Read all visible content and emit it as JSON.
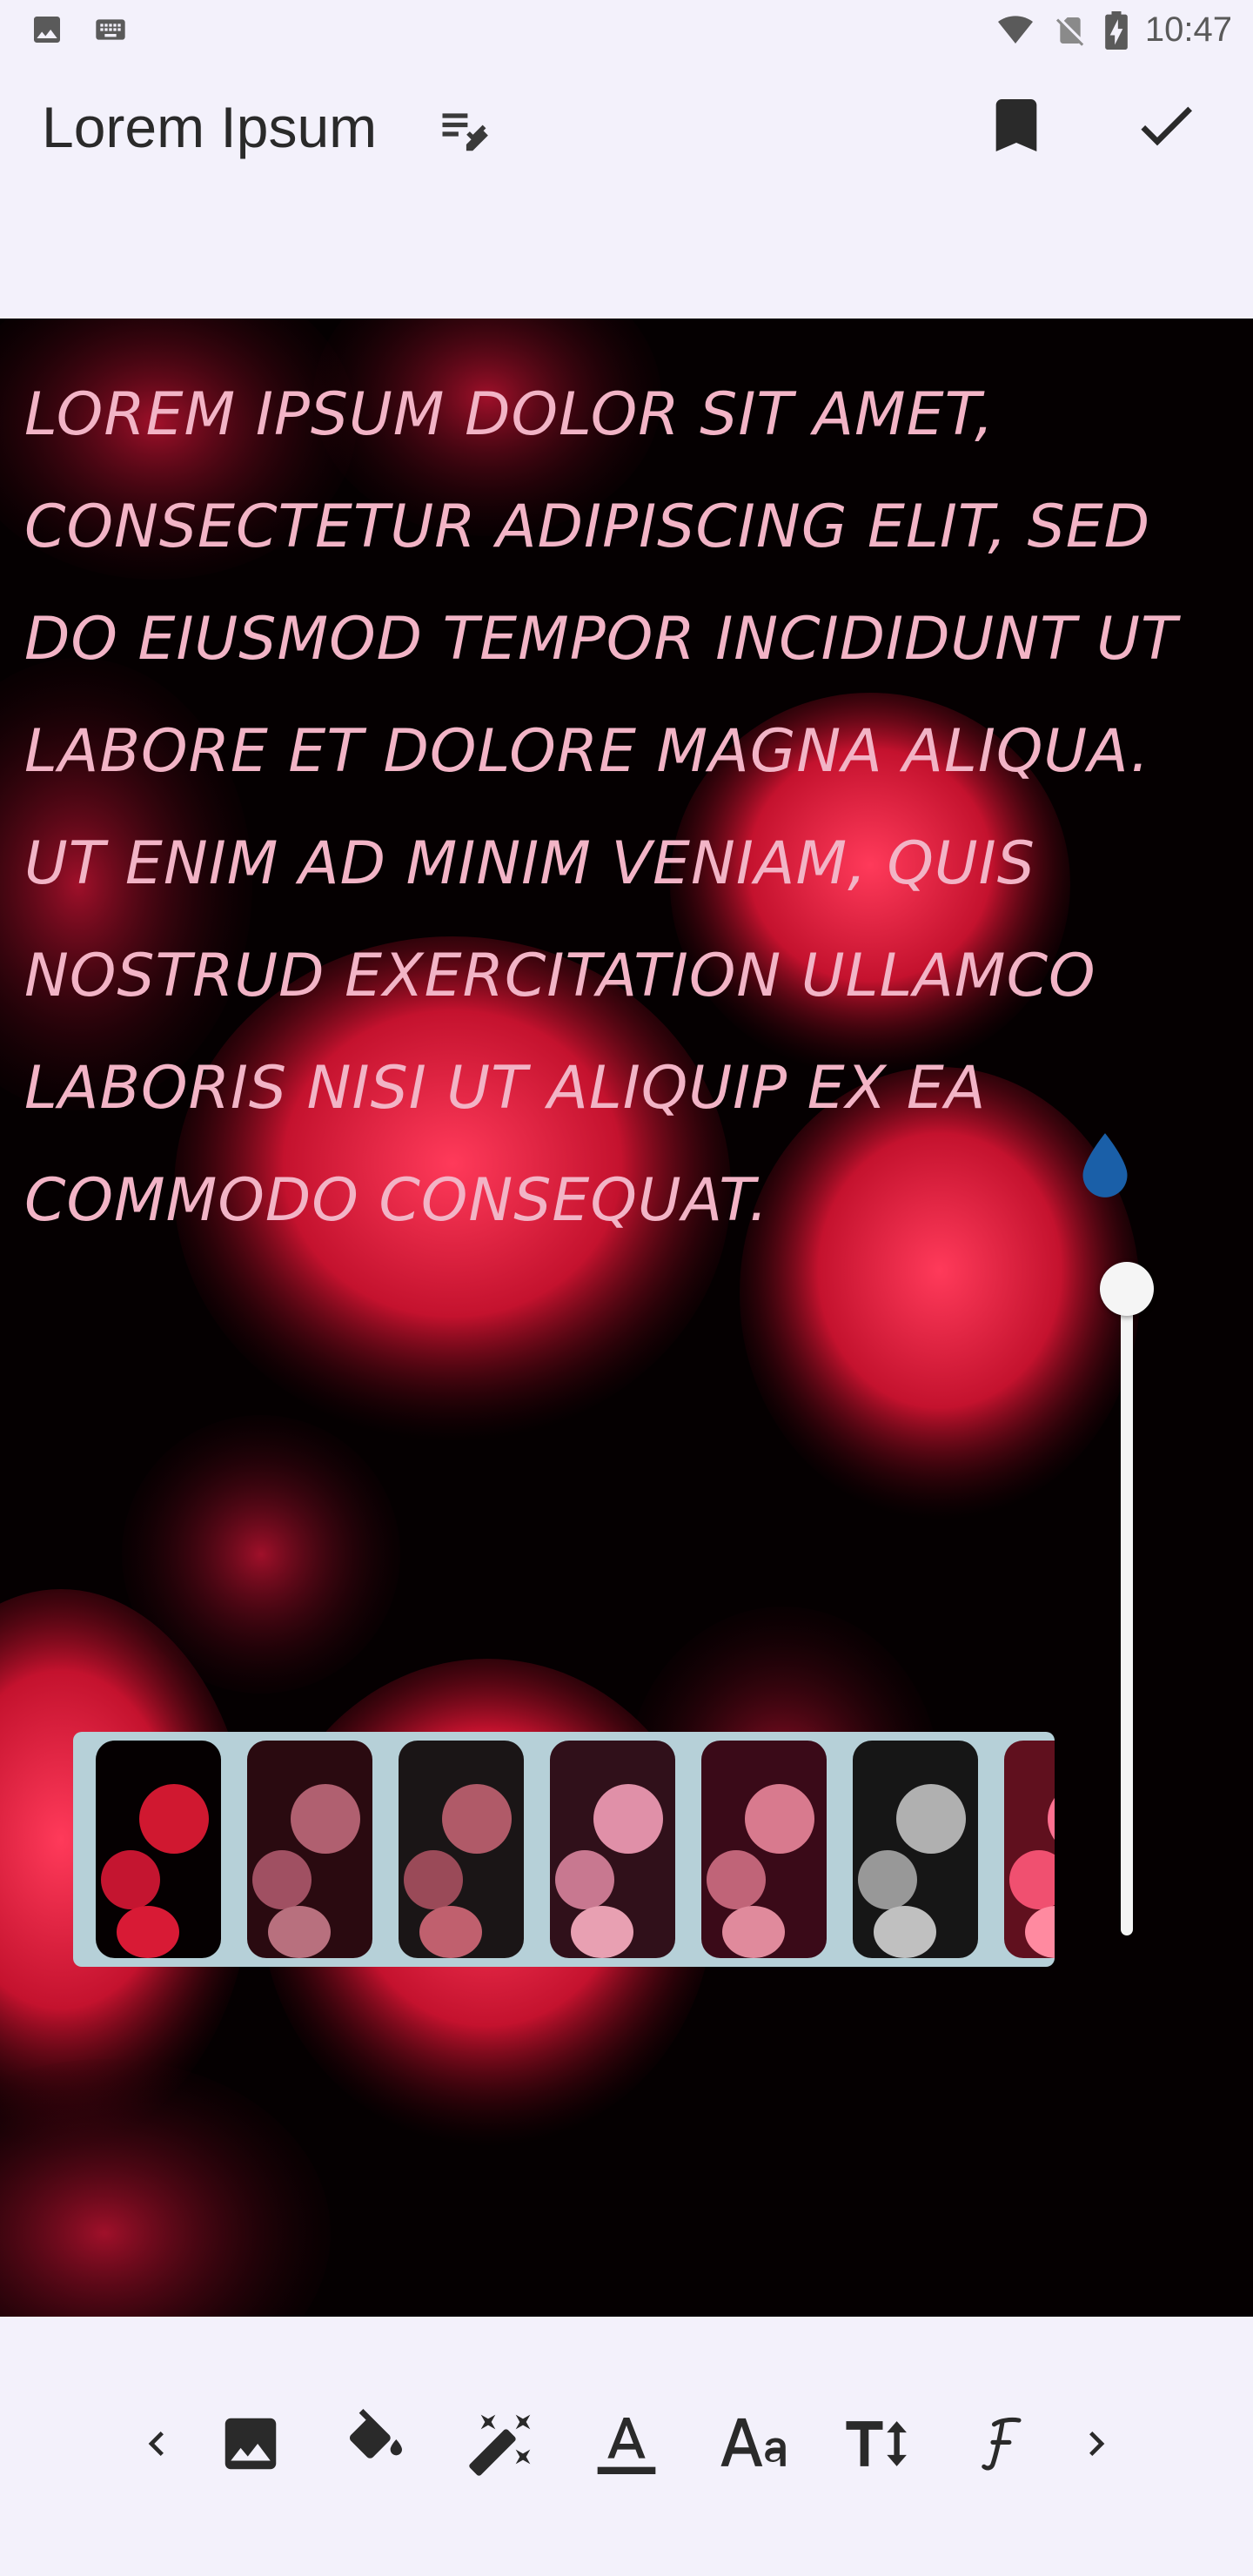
{
  "status": {
    "time": "10:47",
    "icons": [
      "image-icon",
      "keyboard-icon",
      "wifi-icon",
      "no-sim-icon",
      "battery-charging-icon"
    ]
  },
  "header": {
    "title": "Lorem Ipsum",
    "icons": [
      "edit-note-icon",
      "bookmark-icon",
      "check-icon"
    ]
  },
  "canvas": {
    "text": "LOREM IPSUM DOLOR SIT AMET, CONSECTETUR ADIPISCING ELIT, SED DO EIUSMOD TEMPOR INCIDIDUNT UT LABORE ET DOLORE MAGNA ALIQUA. UT ENIM AD MINIM VENIAM, QUIS NOSTRUD EXERCITATION ULLAMCO LABORIS NISI UT ALIQUIP EX EA COMMODO CONSEQUAT.",
    "text_color": "#f2b4c6",
    "handle_color": "#1a5fa8",
    "slider_level": 1.0
  },
  "filters": {
    "items": [
      "filter-1",
      "filter-2",
      "filter-3",
      "filter-4",
      "filter-5",
      "filter-6",
      "filter-7"
    ],
    "tints": [
      "#c01530",
      "#7a1a2a",
      "#6b1f26",
      "#a3203a",
      "#8a1a2c",
      "#6a6a6a",
      "#e04060"
    ]
  },
  "toolbar": {
    "icons": [
      "chevron-left-icon",
      "image-icon",
      "paint-bucket-icon",
      "magic-wand-icon",
      "text-color-icon",
      "font-size-icon",
      "text-height-icon",
      "font-style-icon",
      "chevron-right-icon"
    ]
  }
}
